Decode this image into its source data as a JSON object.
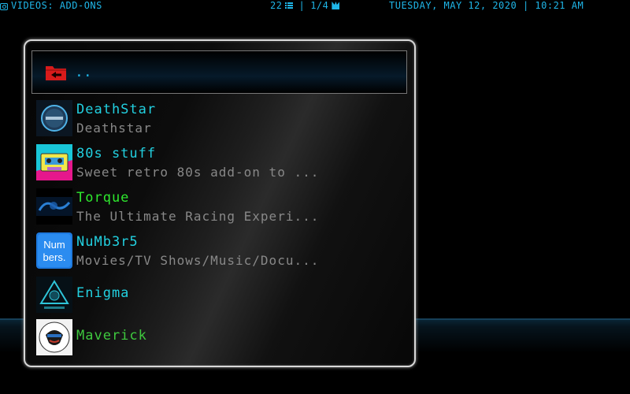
{
  "top_bar": {
    "section_label": "VIDEOS: ADD-ONS",
    "item_count": "22",
    "page_indicator": "1/4",
    "datetime": "TUESDAY, MAY 12, 2020 | 10:21 AM",
    "separator": "|"
  },
  "parent_folder": {
    "label": ".."
  },
  "addons": [
    {
      "title": " DeathStar",
      "subtitle": "Deathstar",
      "title_color": "#22d0e0",
      "icon": "deathstar-logo-icon"
    },
    {
      "title": "80s stuff",
      "subtitle": "Sweet retro 80s add-on to ...",
      "title_color": "#22d0e0",
      "icon": "cassette-tape-icon"
    },
    {
      "title": "Torque",
      "subtitle": "The Ultimate Racing Experi...",
      "title_color": "#2ee82e",
      "icon": "torque-logo-icon"
    },
    {
      "title": "NuMb3r5",
      "subtitle": "Movies/TV Shows/Music/Docu...",
      "title_color": "#22d0e0",
      "icon": "numbers-logo-icon"
    },
    {
      "title": "Enigma",
      "subtitle": "",
      "title_color": "#22d0e0",
      "icon": "enigma-logo-icon"
    },
    {
      "title": "Maverick",
      "subtitle": "",
      "title_color": "#3ec93e",
      "icon": "maverick-logo-icon"
    }
  ]
}
